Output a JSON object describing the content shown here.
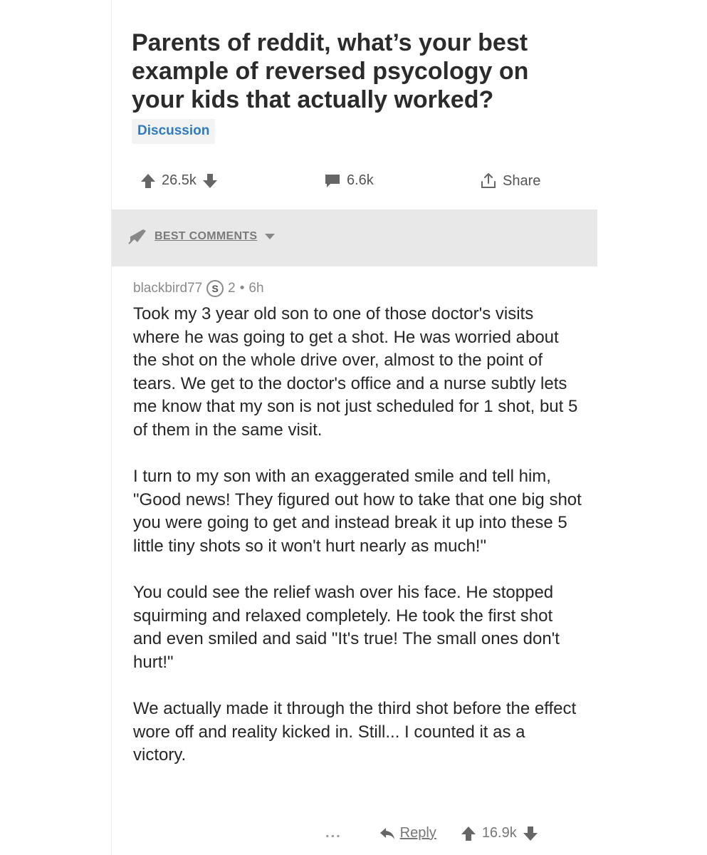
{
  "post": {
    "title": "Parents of reddit, what’s your best example of reversed psycology on your kids that actually worked?",
    "flair": "Discussion",
    "score": "26.5k",
    "comments_count": "6.6k",
    "share_label": "Share"
  },
  "sort": {
    "label": "BEST COMMENTS"
  },
  "comment": {
    "author": "blackbird77",
    "coin_glyph": "S",
    "coin_count": "2",
    "separator": "•",
    "age": "6h",
    "paragraphs": [
      "Took my 3 year old son to one of those doctor's visits where he was going to get a shot. He was worried about the shot on the whole drive over, almost to the point of tears. We get to the doctor's office and a nurse subtly lets me know that my son is not just scheduled for 1 shot, but 5 of them in the same visit.",
      "I turn to my son with an exaggerated smile and tell him, \"Good news! They figured out how to take that one big shot you were going to get and instead break it up into these 5 little tiny shots so it won't hurt nearly as much!\"",
      "You could see the relief wash over his face. He stopped squirming and relaxed completely. He took the first shot and even smiled and said \"It's true! The small ones don't hurt!\"",
      "We actually made it through the third shot before the effect wore off and reality kicked in. Still... I counted it as a victory."
    ],
    "more_label": "...",
    "reply_label": "Reply",
    "score": "16.9k"
  },
  "colors": {
    "flair_text": "#2f7bbf",
    "sort_bar_bg": "#e8e8e8",
    "icon_gray": "#666666"
  }
}
